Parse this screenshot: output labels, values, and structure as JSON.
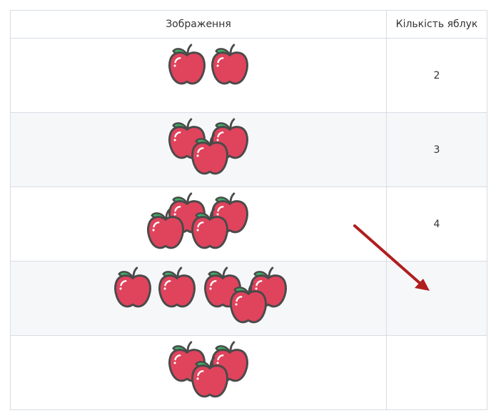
{
  "table": {
    "headers": [
      "Зображення",
      "Кількість яблук"
    ],
    "rows": [
      {
        "apples": 2,
        "count": "2"
      },
      {
        "apples": 3,
        "count": "3"
      },
      {
        "apples": 4,
        "count": "4"
      },
      {
        "apples": 5,
        "count": ""
      },
      {
        "apples": 3,
        "count": ""
      }
    ]
  },
  "icons": {
    "apple": "apple-icon",
    "arrow": "arrow-icon"
  },
  "colors": {
    "apple_fill": "#e0435c",
    "apple_outline": "#4a4a4a",
    "leaf": "#3fae66",
    "arrow": "#b01e1e",
    "border": "#d6dde3",
    "alt_row": "#f6f7f9"
  }
}
